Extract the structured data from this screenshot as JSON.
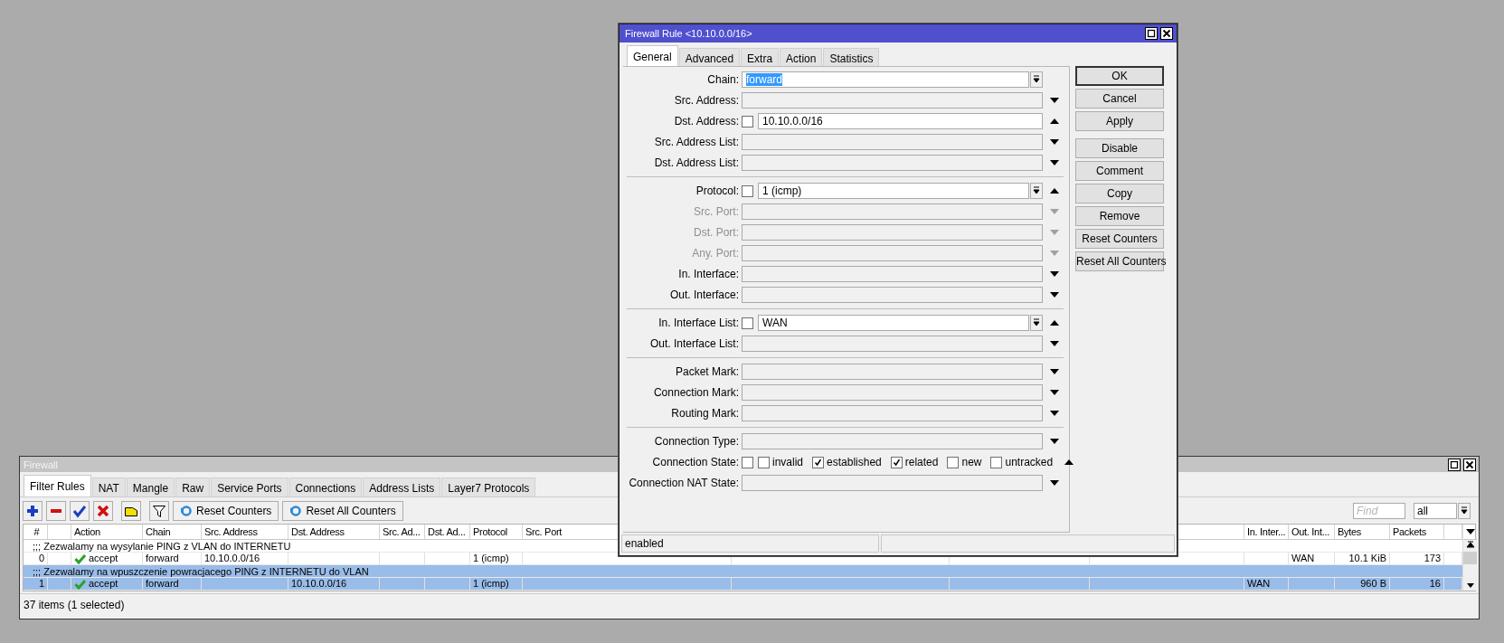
{
  "dialog": {
    "title": "Firewall Rule <10.10.0.0/16>",
    "tabs": [
      {
        "label": "General",
        "selected": true
      },
      {
        "label": "Advanced",
        "selected": false
      },
      {
        "label": "Extra",
        "selected": false
      },
      {
        "label": "Action",
        "selected": false
      },
      {
        "label": "Statistics",
        "selected": false
      }
    ],
    "groups": [
      [
        {
          "label": "Chain:",
          "kind": "select",
          "value": "forward",
          "highlighted": true,
          "disabled": false
        },
        {
          "label": "Src. Address:",
          "kind": "empty",
          "disabled": false,
          "expanded": false
        },
        {
          "label": "Dst. Address:",
          "kind": "text",
          "invert": false,
          "value": "10.10.0.0/16",
          "disabled": false,
          "expanded": true
        },
        {
          "label": "Src. Address List:",
          "kind": "empty",
          "disabled": false,
          "expanded": false
        },
        {
          "label": "Dst. Address List:",
          "kind": "empty",
          "disabled": false,
          "expanded": false
        }
      ],
      [
        {
          "label": "Protocol:",
          "kind": "select",
          "invert": false,
          "value": "1 (icmp)",
          "highlighted": false,
          "disabled": false,
          "expanded": true
        },
        {
          "label": "Src. Port:",
          "kind": "empty",
          "disabled": true,
          "expanded": false
        },
        {
          "label": "Dst. Port:",
          "kind": "empty",
          "disabled": true,
          "expanded": false
        },
        {
          "label": "Any. Port:",
          "kind": "empty",
          "disabled": true,
          "expanded": false
        },
        {
          "label": "In. Interface:",
          "kind": "empty",
          "disabled": false,
          "expanded": false
        },
        {
          "label": "Out. Interface:",
          "kind": "empty",
          "disabled": false,
          "expanded": false
        }
      ],
      [
        {
          "label": "In. Interface List:",
          "kind": "select",
          "invert": false,
          "value": "WAN",
          "highlighted": false,
          "disabled": false,
          "expanded": true
        },
        {
          "label": "Out. Interface List:",
          "kind": "empty",
          "disabled": false,
          "expanded": false
        }
      ],
      [
        {
          "label": "Packet Mark:",
          "kind": "empty",
          "disabled": false,
          "expanded": false
        },
        {
          "label": "Connection Mark:",
          "kind": "empty",
          "disabled": false,
          "expanded": false
        },
        {
          "label": "Routing Mark:",
          "kind": "empty",
          "disabled": false,
          "expanded": false
        }
      ],
      [
        {
          "label": "Connection Type:",
          "kind": "empty",
          "disabled": false,
          "expanded": false
        },
        {
          "label": "Connection State:",
          "kind": "checks",
          "invert": false,
          "disabled": false,
          "expanded": true,
          "options": [
            {
              "label": "invalid",
              "checked": false
            },
            {
              "label": "established",
              "checked": true
            },
            {
              "label": "related",
              "checked": true
            },
            {
              "label": "new",
              "checked": false
            },
            {
              "label": "untracked",
              "checked": false
            }
          ]
        },
        {
          "label": "Connection NAT State:",
          "kind": "empty",
          "disabled": false,
          "expanded": false
        }
      ]
    ],
    "buttons": [
      [
        {
          "label": "OK",
          "default": true
        },
        {
          "label": "Cancel",
          "default": false
        },
        {
          "label": "Apply",
          "default": false
        }
      ],
      [
        {
          "label": "Disable",
          "default": false
        },
        {
          "label": "Comment",
          "default": false
        },
        {
          "label": "Copy",
          "default": false
        },
        {
          "label": "Remove",
          "default": false
        },
        {
          "label": "Reset Counters",
          "default": false
        },
        {
          "label": "Reset All Counters",
          "default": false
        }
      ]
    ],
    "status": "enabled"
  },
  "firewall": {
    "title": "Firewall",
    "tabs": [
      {
        "label": "Filter Rules",
        "selected": true
      },
      {
        "label": "NAT",
        "selected": false
      },
      {
        "label": "Mangle",
        "selected": false
      },
      {
        "label": "Raw",
        "selected": false
      },
      {
        "label": "Service Ports",
        "selected": false
      },
      {
        "label": "Connections",
        "selected": false
      },
      {
        "label": "Address Lists",
        "selected": false
      },
      {
        "label": "Layer7 Protocols",
        "selected": false
      }
    ],
    "toolbar": [
      {
        "kind": "add"
      },
      {
        "kind": "remove"
      },
      {
        "kind": "enable"
      },
      {
        "kind": "disable"
      },
      {
        "kind": "comment"
      },
      {
        "kind": "filter"
      },
      {
        "kind": "reset",
        "label": "Reset Counters"
      },
      {
        "kind": "reset",
        "label": "Reset All Counters"
      }
    ],
    "find": {
      "placeholder": "Find"
    },
    "filter_select": {
      "value": "all"
    },
    "columns": [
      "#",
      "Action",
      "Chain",
      "Src. Address",
      "Dst. Address",
      "Src. Ad...",
      "Dst. Ad...",
      "Protocol",
      "Src. Port",
      "In. Inter...",
      "Out. Int...",
      "Bytes",
      "Packets"
    ],
    "rows": [
      {
        "kind": "comment",
        "text": ";;; Zezwalamy na wysylanie PING z VLAN do INTERNETU",
        "selected": false
      },
      {
        "kind": "rule",
        "selected": false,
        "cells": [
          "0",
          "accept",
          "forward",
          "10.10.0.0/16",
          null,
          null,
          null,
          "1 (icmp)",
          null,
          null,
          "WAN",
          "10.1 KiB",
          "173"
        ]
      },
      {
        "kind": "comment",
        "text": ";;; Zezwalamy na wpuszczenie powracjacego PING z INTERNETU do VLAN",
        "selected": true
      },
      {
        "kind": "rule",
        "selected": true,
        "cells": [
          "1",
          "accept",
          "forward",
          null,
          "10.10.0.0/16",
          null,
          null,
          "1 (icmp)",
          null,
          "WAN",
          null,
          "960 B",
          "16"
        ]
      }
    ],
    "status": "37 items (1 selected)"
  }
}
